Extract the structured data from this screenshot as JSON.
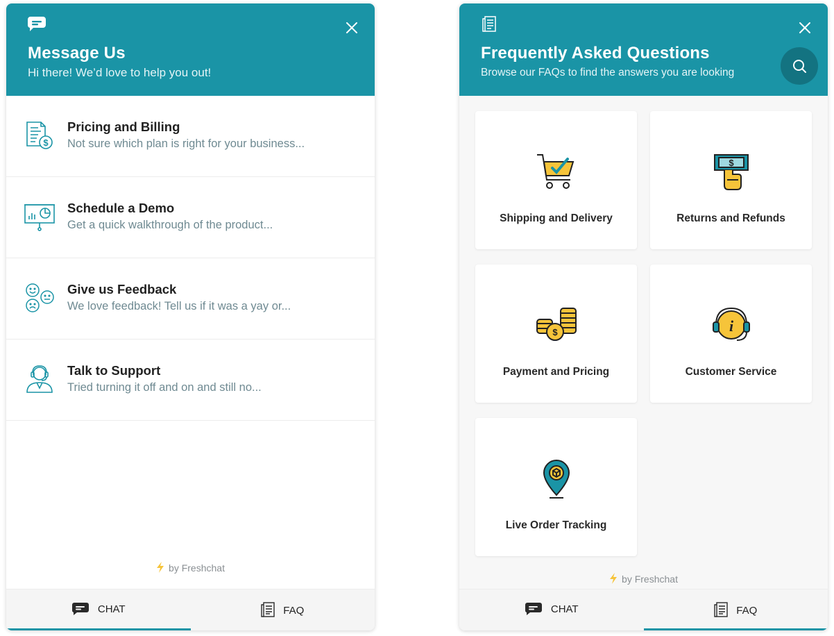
{
  "chat_widget": {
    "icon": "chat-bubble-icon",
    "title": "Message Us",
    "subtitle": "Hi there! We’d love to help you out!",
    "topics": [
      {
        "title": "Pricing and Billing",
        "description": "Not sure which plan is right for your business...",
        "icon": "invoice-dollar-icon"
      },
      {
        "title": "Schedule a Demo",
        "description": "Get a quick walkthrough of the product...",
        "icon": "presentation-chart-icon"
      },
      {
        "title": "Give us Feedback",
        "description": "We love feedback! Tell us if it was a yay or...",
        "icon": "emoji-faces-icon"
      },
      {
        "title": "Talk to Support",
        "description": "Tried turning it off and on and still no...",
        "icon": "support-agent-icon"
      }
    ],
    "powered_by": "by Freshchat",
    "tabs": [
      {
        "label": "CHAT",
        "active": true
      },
      {
        "label": "FAQ",
        "active": false
      }
    ]
  },
  "faq_widget": {
    "icon": "document-icon",
    "title": "Frequently Asked Questions",
    "subtitle": "Browse our FAQs to find the answers you are looking",
    "categories": [
      {
        "label": "Shipping and Delivery",
        "icon": "shopping-cart-icon"
      },
      {
        "label": "Returns and Refunds",
        "icon": "cash-refund-icon"
      },
      {
        "label": "Payment and Pricing",
        "icon": "coins-icon"
      },
      {
        "label": "Customer Service",
        "icon": "headset-info-icon"
      },
      {
        "label": "Live Order Tracking",
        "icon": "location-pin-icon"
      }
    ],
    "powered_by": "by Freshchat",
    "tabs": [
      {
        "label": "CHAT",
        "active": false
      },
      {
        "label": "FAQ",
        "active": true
      }
    ]
  },
  "colors": {
    "brand": "#1a94a6",
    "search_button": "#137381",
    "icon_accent": "#f6c43a"
  }
}
